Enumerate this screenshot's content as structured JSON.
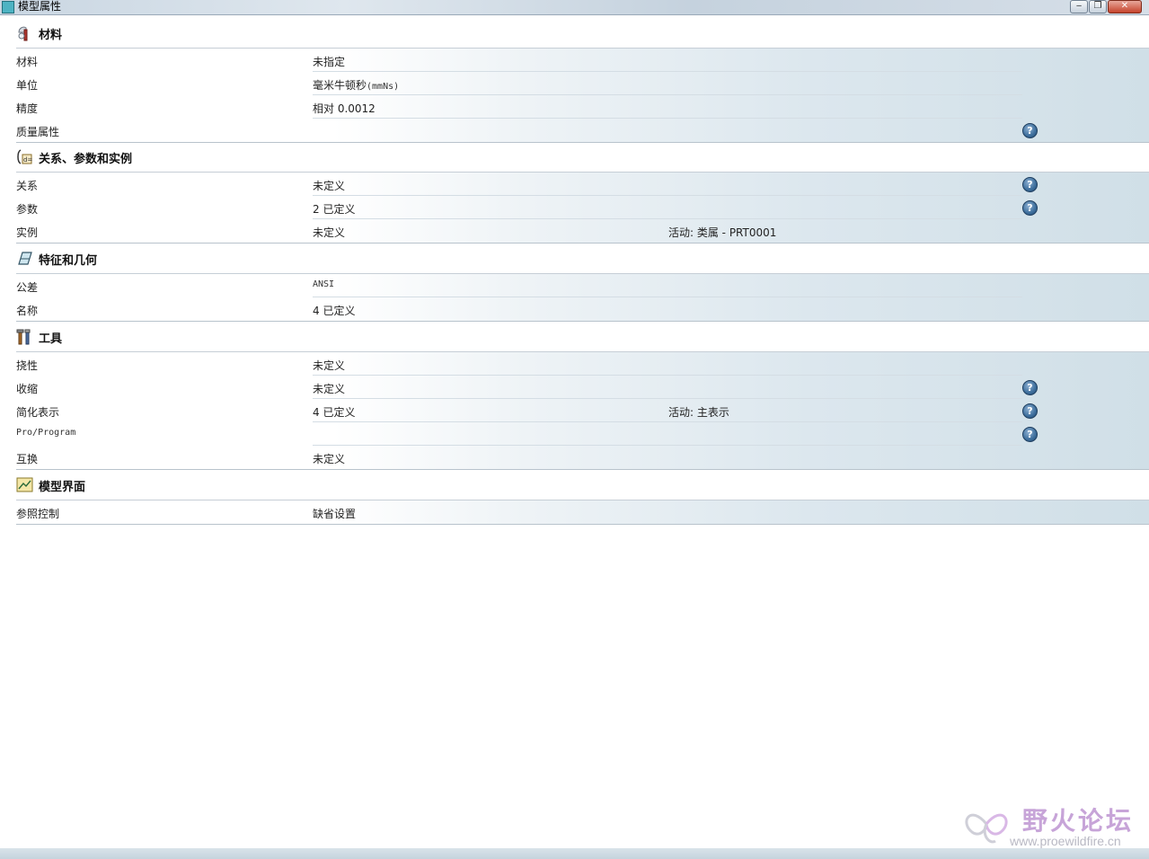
{
  "window": {
    "title": "模型属性",
    "buttons": [
      "minimize",
      "restore",
      "close"
    ]
  },
  "sections": [
    {
      "title": "材料",
      "icon": "material-icon",
      "rows": [
        {
          "label": "材料",
          "value": "未指定",
          "extra": "",
          "help": false
        },
        {
          "label": "单位",
          "value": "毫米牛顿秒",
          "value_suffix": "(mmNs)",
          "extra": "",
          "help": false
        },
        {
          "label": "精度",
          "value": "相对 0.0012",
          "extra": "",
          "help": false
        },
        {
          "label": "质量属性",
          "value": "",
          "extra": "",
          "help": true
        }
      ]
    },
    {
      "title": "关系、参数和实例",
      "icon": "relations-icon",
      "rows": [
        {
          "label": "关系",
          "value": "未定义",
          "extra": "",
          "help": true
        },
        {
          "label": "参数",
          "value": "2 已定义",
          "extra": "",
          "help": true
        },
        {
          "label": "实例",
          "value": "未定义",
          "extra": "活动: 类属 - PRT0001",
          "help": false
        }
      ]
    },
    {
      "title": "特征和几何",
      "icon": "feature-geometry-icon",
      "rows": [
        {
          "label": "公差",
          "value": "ANSI",
          "extra": "",
          "help": false
        },
        {
          "label": "名称",
          "value": "4 已定义",
          "extra": "",
          "help": false
        }
      ]
    },
    {
      "title": "工具",
      "icon": "tools-icon",
      "rows": [
        {
          "label": "挠性",
          "value": "未定义",
          "extra": "",
          "help": false
        },
        {
          "label": "收缩",
          "value": "未定义",
          "extra": "",
          "help": true
        },
        {
          "label": "简化表示",
          "value": "4 已定义",
          "extra": "活动: 主表示",
          "help": true
        },
        {
          "label": "Pro/Program",
          "value": "",
          "extra": "",
          "help": true
        },
        {
          "label": "互换",
          "value": "未定义",
          "extra": "",
          "help": false
        }
      ]
    },
    {
      "title": "模型界面",
      "icon": "model-interface-icon",
      "rows": [
        {
          "label": "参照控制",
          "value": "缺省设置",
          "extra": "",
          "help": false
        }
      ]
    }
  ],
  "watermark": {
    "name": "野火论坛",
    "url": "www.proewildfire.cn"
  },
  "colors": {
    "row_gradient_end": "#d0dfe7",
    "help_icon": "#3c6d9b",
    "watermark_text": "#c7a4d8"
  }
}
